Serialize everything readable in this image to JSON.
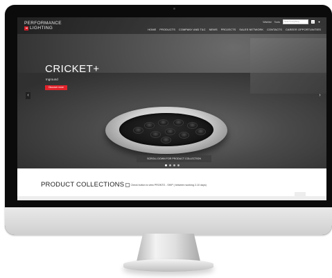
{
  "brand": {
    "line1": "PERFORMANCE",
    "line2": "LIGHTING"
  },
  "utility": {
    "links": [
      "Wishlist",
      "Tools"
    ],
    "search_placeholder": "Search anything",
    "search_icon": "search-icon"
  },
  "nav": [
    "HOME",
    "PRODUCTS",
    "COMPANY AND T&C",
    "NEWS",
    "PROJECTS",
    "SALES NETWORK",
    "CONTACTS",
    "CAREER OPPORTUNITIES"
  ],
  "hero": {
    "title": "CRICKET+",
    "subtitle": "Inground",
    "button": "Discover more",
    "scroll_hint": "SCROLL DOWN FOR PRODUCT COLLECTION",
    "slides": 4,
    "active_slide": 1
  },
  "collections": {
    "title": "PRODUCT COLLECTIONS",
    "checkbox_label": "Check button to view PRONTO - SHIP ( between working 2-10 days)"
  },
  "colors": {
    "accent": "#e2232b"
  }
}
